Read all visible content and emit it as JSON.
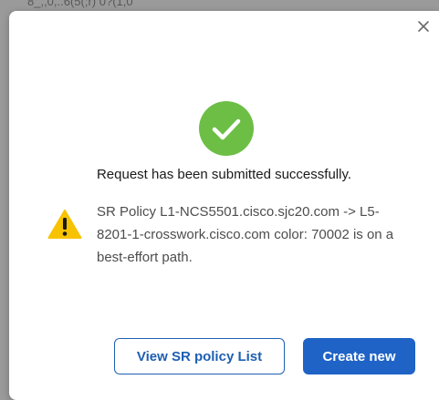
{
  "background": {
    "partial_text": "8_,,0,..6(5(;r) 0?(1,0"
  },
  "dialog": {
    "close_icon": "close-icon",
    "success_icon": "check-circle-icon",
    "success_message": "Request has been submitted successfully.",
    "warning_icon": "warning-triangle-icon",
    "warning_message": "SR Policy L1-NCS5501.cisco.sjc20.com -> L5-8201-1-crosswork.cisco.com color: 70002 is on a best-effort path.",
    "buttons": {
      "view_list": "View SR policy List",
      "create_new": "Create new"
    }
  },
  "colors": {
    "success_green": "#6dbe45",
    "warning_yellow": "#f7c300",
    "primary_blue": "#1f63c6"
  }
}
